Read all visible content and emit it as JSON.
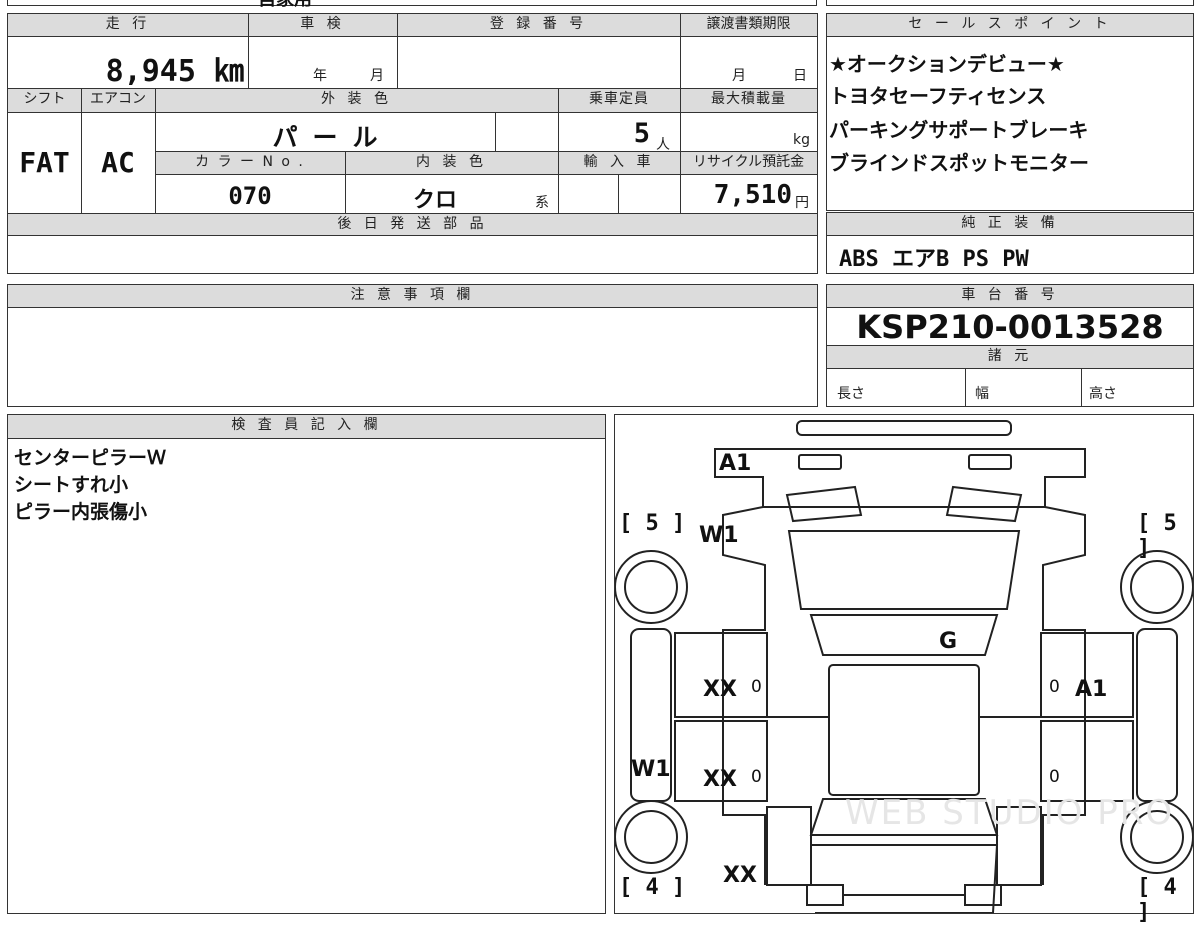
{
  "top_stub": {
    "text": "自家用"
  },
  "vehicle": {
    "mileage_label": "走 行",
    "mileage_value": "8,945 ㎞",
    "inspection_label": "車 検",
    "inspection_year": "年",
    "inspection_month": "月",
    "registration_label": "登 録 番 号",
    "transfer_label": "譲渡書類期限",
    "transfer_month": "月",
    "transfer_day": "日",
    "shift_label": "シフト",
    "shift_value": "FAT",
    "ac_label": "エアコン",
    "ac_value": "AC",
    "exterior_label": "外 装 色",
    "exterior_value": "パ ー ル",
    "capacity_label": "乗車定員",
    "capacity_value": "5",
    "capacity_unit": "人",
    "max_load_label": "最大積載量",
    "max_load_unit": "kg",
    "color_no_label": "カ ラ ー N o .",
    "color_no_value": "070",
    "interior_label": "内 装 色",
    "interior_value": "クロ",
    "interior_unit": "系",
    "import_label": "輸 入 車",
    "recycle_label": "リサイクル預託金",
    "recycle_value": "7,510",
    "recycle_unit": "円",
    "later_parts_label": "後 日 発 送 部 品"
  },
  "sales_points": {
    "label": "セ ー ル ス ポ イ ン ト",
    "items": [
      "★オークションデビュー★",
      "トヨタセーフティセンス",
      "パーキングサポートブレーキ",
      "ブラインドスポットモニター"
    ]
  },
  "equipment": {
    "label": "純 正 装 備",
    "value": "ABS エアB PS PW"
  },
  "notes": {
    "label": "注 意 事 項 欄"
  },
  "chassis": {
    "label": "車 台 番 号",
    "value": "KSP210-0013528",
    "spec_label": "諸 元",
    "length_label": "長さ",
    "width_label": "幅",
    "height_label": "高さ"
  },
  "inspector": {
    "label": "検 査 員 記 入 欄",
    "lines": [
      "センターピラーＷ",
      "シートすれ小",
      "ピラー内張傷小"
    ]
  },
  "diagram": {
    "marks": {
      "front_bumper": "A1",
      "left_front_fender": "W1",
      "windshield": "G",
      "left_front_door": "XX",
      "left_rear_door": "XX",
      "left_rocker": "W1",
      "left_quarter": "XX",
      "right_front_door": "A1",
      "left_front_door_zero": "0",
      "left_rear_door_zero": "0",
      "right_front_door_zero": "0",
      "right_rear_door_zero": "0"
    },
    "tires": {
      "front_left": "5",
      "front_right": "5",
      "rear_left": "4",
      "rear_right": "4"
    },
    "watermark": "WEB STUDIO PRO"
  }
}
